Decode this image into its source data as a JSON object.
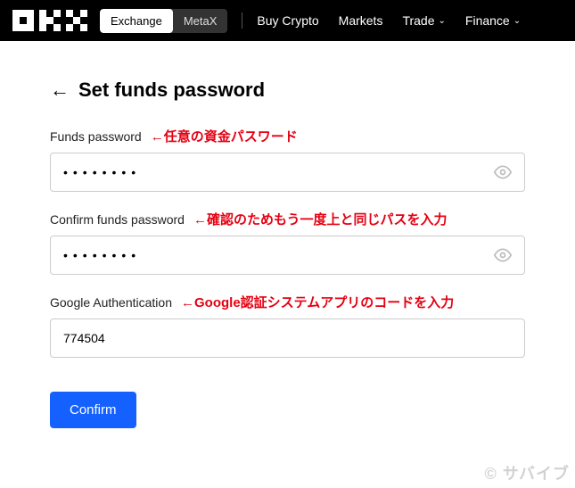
{
  "topbar": {
    "toggle": {
      "exchange": "Exchange",
      "metax": "MetaX"
    },
    "nav": {
      "buy_crypto": "Buy Crypto",
      "markets": "Markets",
      "trade": "Trade",
      "finance": "Finance"
    }
  },
  "page": {
    "title": "Set funds password"
  },
  "fields": {
    "funds_password": {
      "label": "Funds password",
      "annotation": "←任意の資金パスワード",
      "value": "••••••••"
    },
    "confirm_password": {
      "label": "Confirm funds password",
      "annotation": "←確認のためもう一度上と同じパスを入力",
      "value": "••••••••"
    },
    "google_auth": {
      "label": "Google Authentication",
      "annotation": "←Google認証システムアプリのコードを入力",
      "value": "774504"
    }
  },
  "confirm_button": "Confirm",
  "watermark": "© サバイブ"
}
